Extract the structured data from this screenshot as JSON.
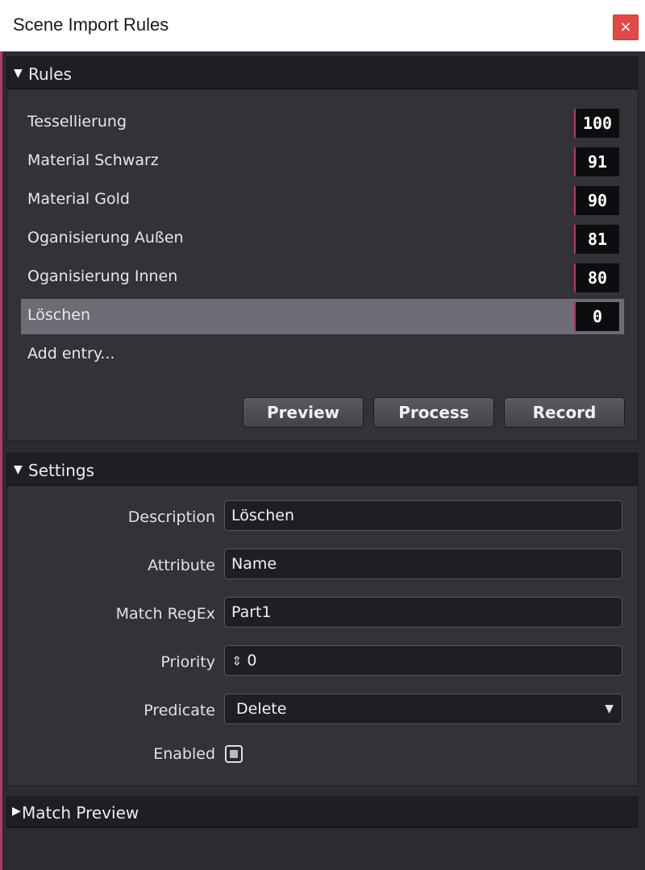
{
  "window": {
    "title": "Scene Import Rules",
    "close_glyph": "×"
  },
  "rules_section": {
    "title": "Rules",
    "expanded": true,
    "items": [
      {
        "name": "Tessellierung",
        "priority": "100",
        "selected": false
      },
      {
        "name": "Material Schwarz",
        "priority": "91",
        "selected": false
      },
      {
        "name": "Material Gold",
        "priority": "90",
        "selected": false
      },
      {
        "name": "Oganisierung Außen",
        "priority": "81",
        "selected": false
      },
      {
        "name": "Oganisierung Innen",
        "priority": "80",
        "selected": false
      },
      {
        "name": "Löschen",
        "priority": "0",
        "selected": true
      }
    ],
    "add_entry": "Add entry...",
    "buttons": {
      "preview": "Preview",
      "process": "Process",
      "record": "Record"
    }
  },
  "settings_section": {
    "title": "Settings",
    "expanded": true,
    "description": {
      "label": "Description",
      "value": "Löschen"
    },
    "attribute": {
      "label": "Attribute",
      "value": "Name"
    },
    "match_regex": {
      "label": "Match RegEx",
      "value": "Part1"
    },
    "priority": {
      "label": "Priority",
      "value": "0",
      "spin_glyph": "⇕"
    },
    "predicate": {
      "label": "Predicate",
      "value": "Delete",
      "arrow_glyph": "▼"
    },
    "enabled": {
      "label": "Enabled",
      "checked": true
    }
  },
  "match_preview_section": {
    "title": "Match Preview",
    "expanded": false
  },
  "icons": {
    "expanded": "▼",
    "collapsed": "▶"
  },
  "colors": {
    "accent": "#b03a6a",
    "close": "#e04a4a",
    "selected_row": "#6d6b73"
  }
}
